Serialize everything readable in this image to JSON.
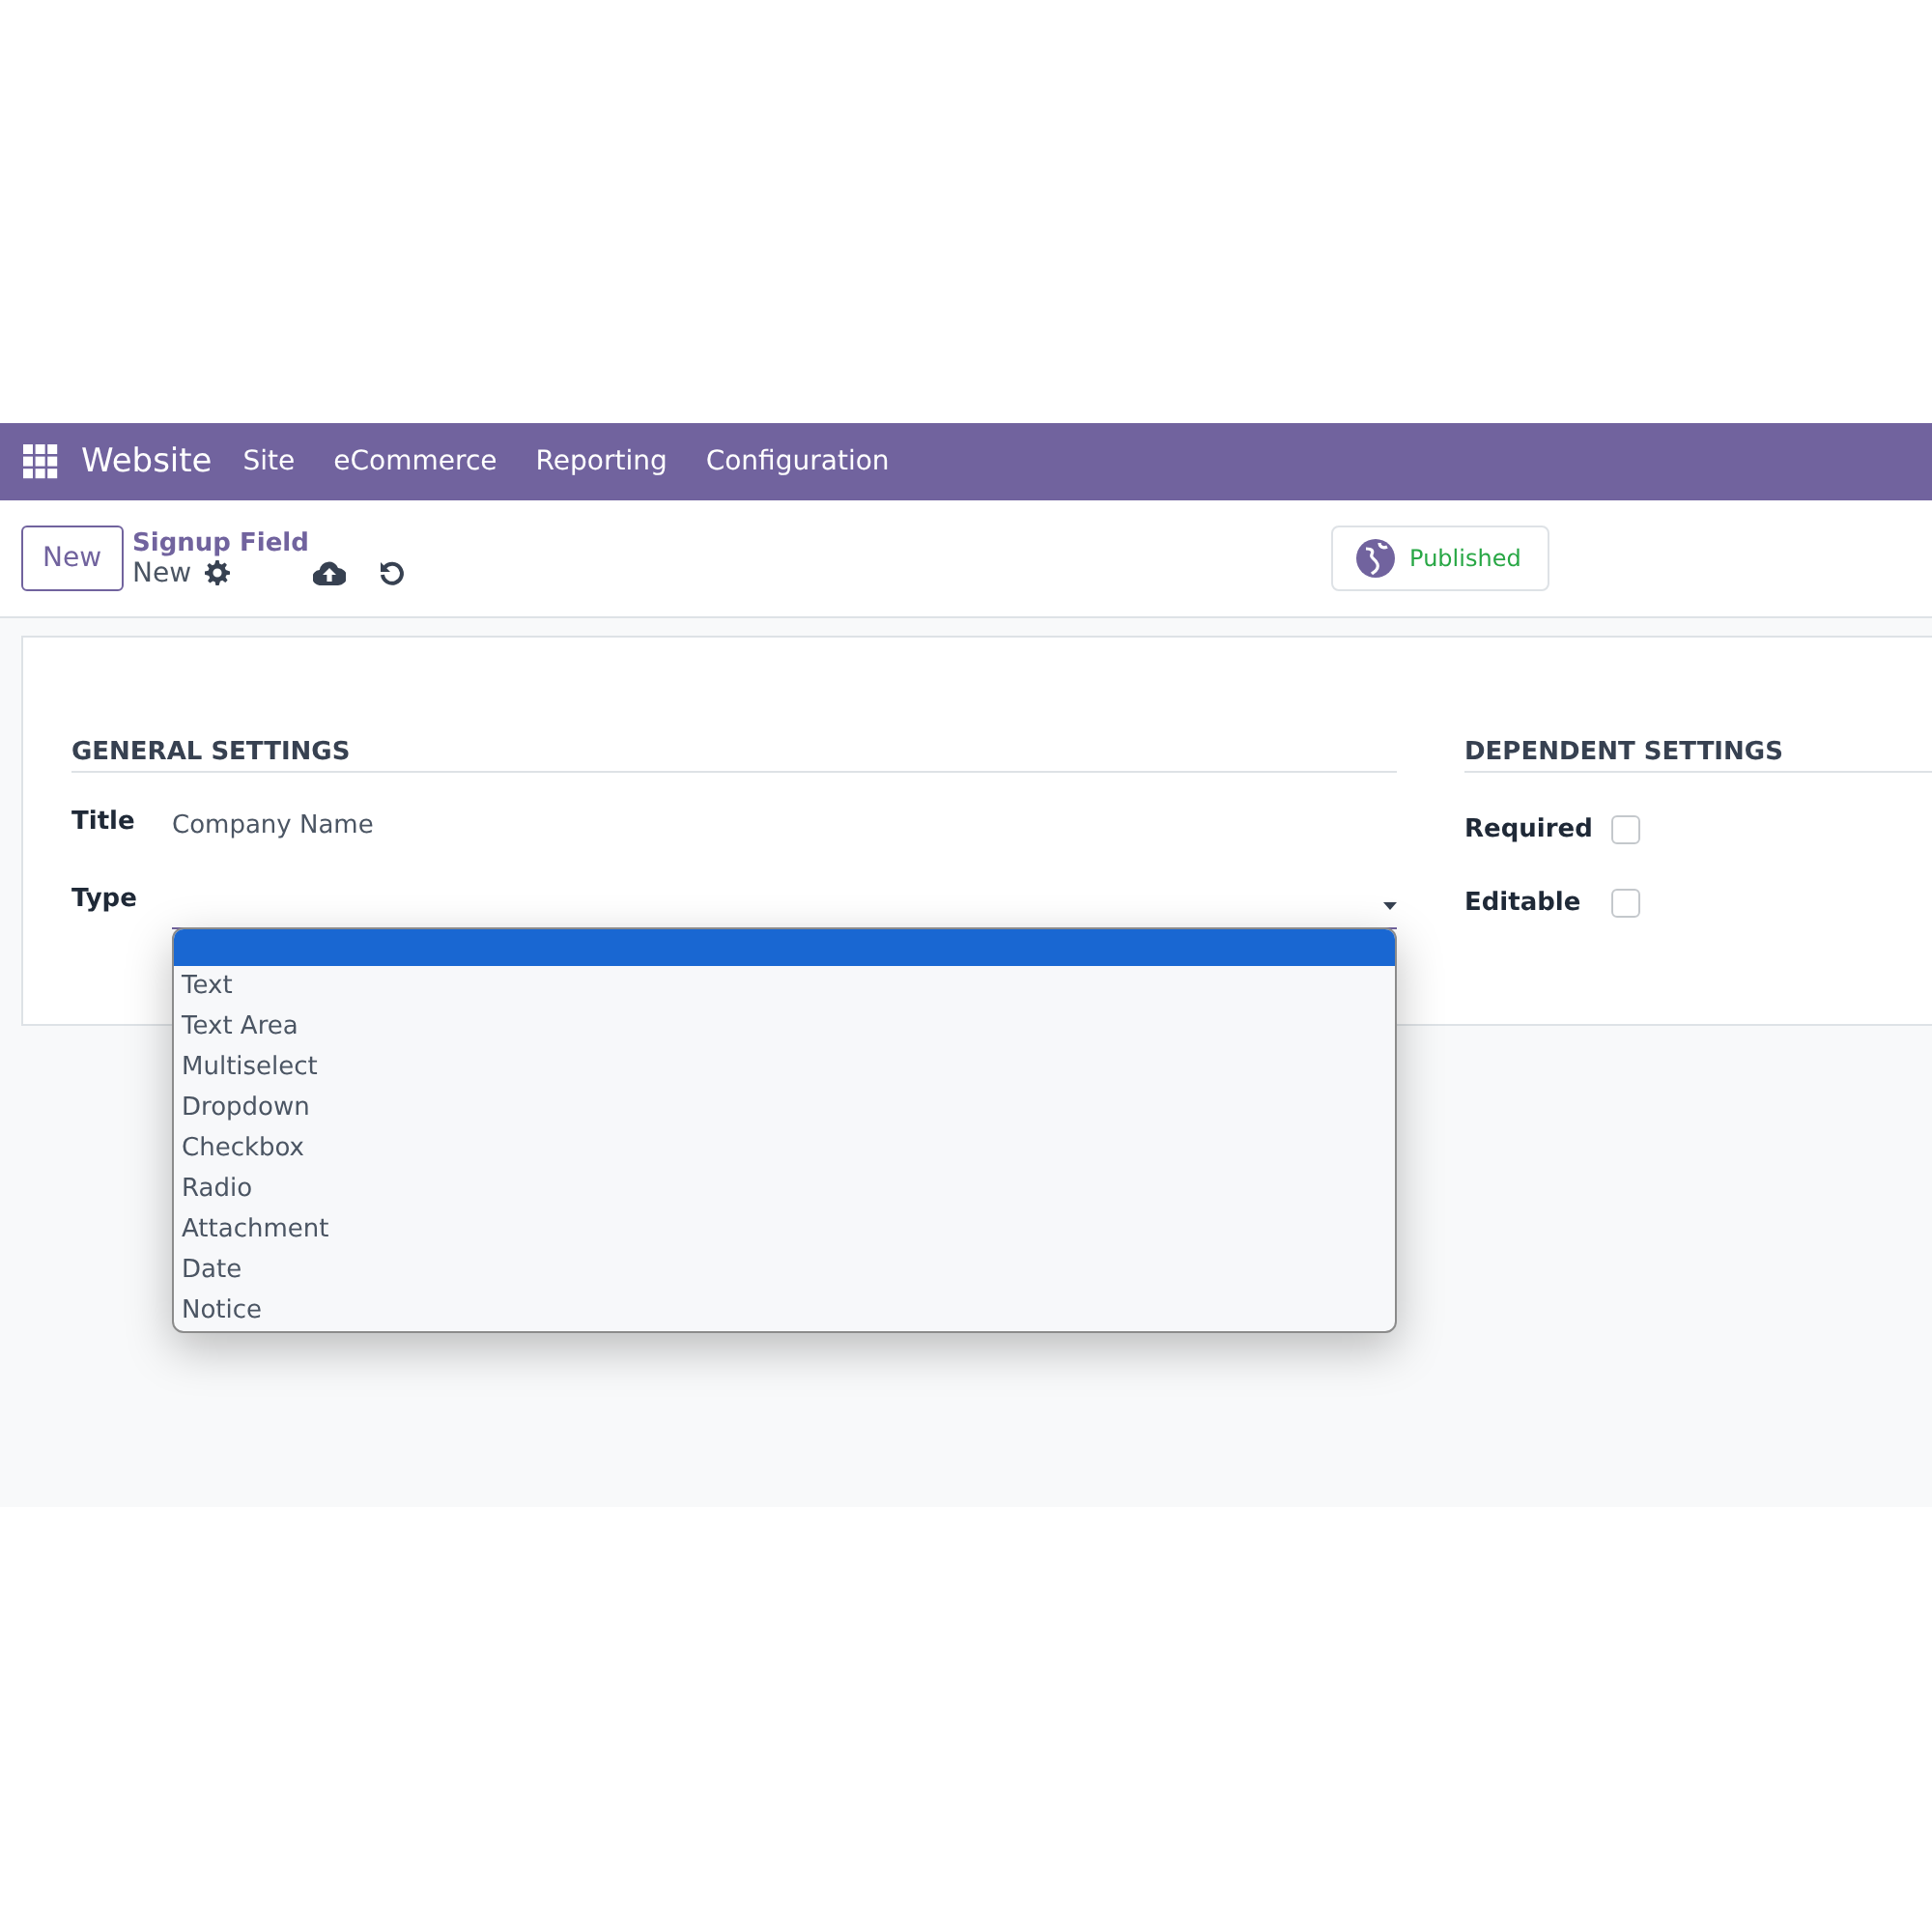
{
  "navbar": {
    "app_name": "Website",
    "menu": [
      "Site",
      "eCommerce",
      "Reporting",
      "Configuration"
    ]
  },
  "control_panel": {
    "new_button": "New",
    "breadcrumb": "Signup Field",
    "record_name": "New",
    "publish_button": {
      "label": "Published",
      "published": true
    }
  },
  "general_settings": {
    "heading": "GENERAL SETTINGS",
    "title_label": "Title",
    "title_value": "Company Name",
    "type_label": "Type"
  },
  "dependent_settings": {
    "heading": "DEPENDENT SETTINGS",
    "fields": [
      {
        "label": "Required",
        "checked": false
      },
      {
        "label": "Editable",
        "checked": false
      }
    ]
  },
  "type_dropdown": {
    "blank_option": {
      "selected": true
    },
    "options": [
      {
        "label": "Text",
        "selected": false
      },
      {
        "label": "Text Area",
        "selected": false
      },
      {
        "label": "Multiselect",
        "selected": false
      },
      {
        "label": "Dropdown",
        "selected": false
      },
      {
        "label": "Checkbox",
        "selected": false
      },
      {
        "label": "Radio",
        "selected": false
      },
      {
        "label": "Attachment",
        "selected": false
      },
      {
        "label": "Date",
        "selected": false
      },
      {
        "label": "Notice",
        "selected": false
      }
    ]
  }
}
